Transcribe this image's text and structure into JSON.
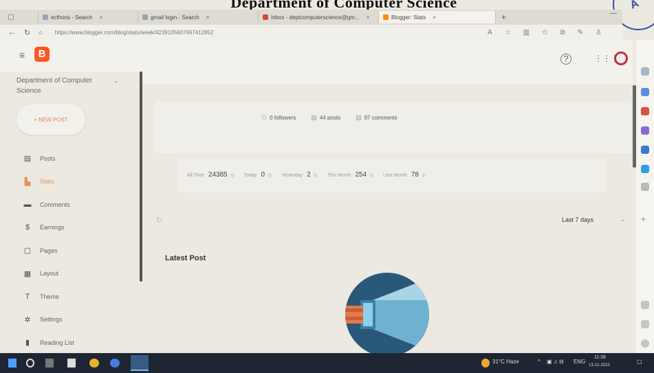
{
  "heading": "Department of Computer Science",
  "browser": {
    "tabs": [
      {
        "label": "ecthoris - Search"
      },
      {
        "label": "gmail login - Search"
      },
      {
        "label": "Inbox - deptcomputerscience@gm..."
      },
      {
        "label": "Blogger: Stats"
      }
    ],
    "new_tab": "+",
    "url": "https://www.blogger.com/blog/stats/week/4239105607697412852"
  },
  "app": {
    "logo_letter": "B",
    "blog_name": "Department of Computer Science",
    "new_post": "+ NEW POST",
    "nav": [
      {
        "label": "Posts",
        "icon": "posts-icon",
        "glyph": "▤"
      },
      {
        "label": "Stats",
        "icon": "stats-icon",
        "glyph": "▙"
      },
      {
        "label": "Comments",
        "icon": "comments-icon",
        "glyph": "▬"
      },
      {
        "label": "Earnings",
        "icon": "earnings-icon",
        "glyph": "$"
      },
      {
        "label": "Pages",
        "icon": "pages-icon",
        "glyph": "▢"
      },
      {
        "label": "Layout",
        "icon": "layout-icon",
        "glyph": "▦"
      },
      {
        "label": "Theme",
        "icon": "theme-icon",
        "glyph": "T"
      },
      {
        "label": "Settings",
        "icon": "settings-icon",
        "glyph": "✲"
      },
      {
        "label": "Reading List",
        "icon": "reading-list-icon",
        "glyph": "▮"
      }
    ],
    "selected_nav": "Stats"
  },
  "overview": {
    "followers": "0 followers",
    "posts": "44 posts",
    "comments": "97 comments"
  },
  "pageviews": [
    {
      "label": "All Time",
      "value": "24385"
    },
    {
      "label": "Today",
      "value": "0"
    },
    {
      "label": "Yesterday",
      "value": "2"
    },
    {
      "label": "This Month",
      "value": "254"
    },
    {
      "label": "Last Month",
      "value": "78"
    }
  ],
  "range": {
    "selected": "Last 7 days"
  },
  "latest_post": "Latest Post",
  "taskbar": {
    "weather": "31°C Haze",
    "lang": "ENG",
    "time": "11:36",
    "date": "13-12-2023"
  },
  "colors": {
    "accent": "#ff5722",
    "selected_nav": "#e89060",
    "taskbar": "#1d2632"
  }
}
